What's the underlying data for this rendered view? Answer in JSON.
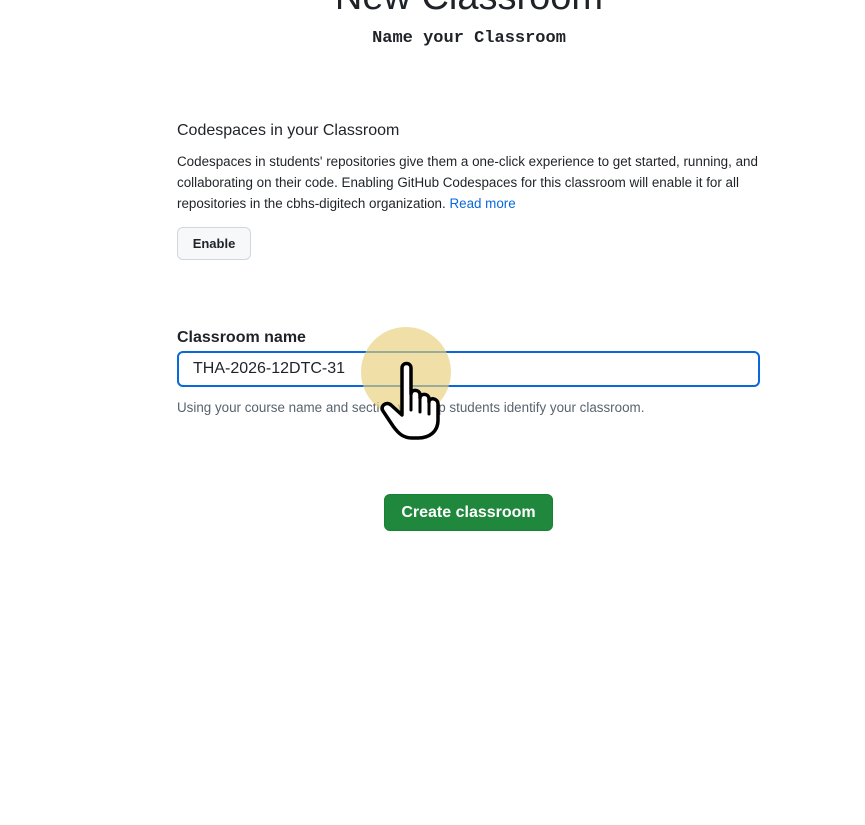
{
  "page": {
    "title": "New Classroom",
    "subtitle": "Name your Classroom"
  },
  "codespaces": {
    "heading": "Codespaces in your Classroom",
    "description": "Codespaces in students' repositories give them a one-click experience to get started, running, and collaborating on their code. Enabling GitHub Codespaces for this classroom will enable it for all repositories in the cbhs-digitech organization.",
    "read_more_label": "Read more",
    "enable_label": "Enable"
  },
  "classroom_name": {
    "label": "Classroom name",
    "value": "THA-2026-12DTC-31",
    "hint": "Using your course name and section will help students identify your classroom."
  },
  "actions": {
    "create_label": "Create classroom"
  },
  "colors": {
    "accent_link": "#0969da",
    "primary_button": "#1f883d",
    "cursor_highlight": "#e8cf78"
  },
  "cursor": {
    "icon": "hand-pointer-icon"
  }
}
